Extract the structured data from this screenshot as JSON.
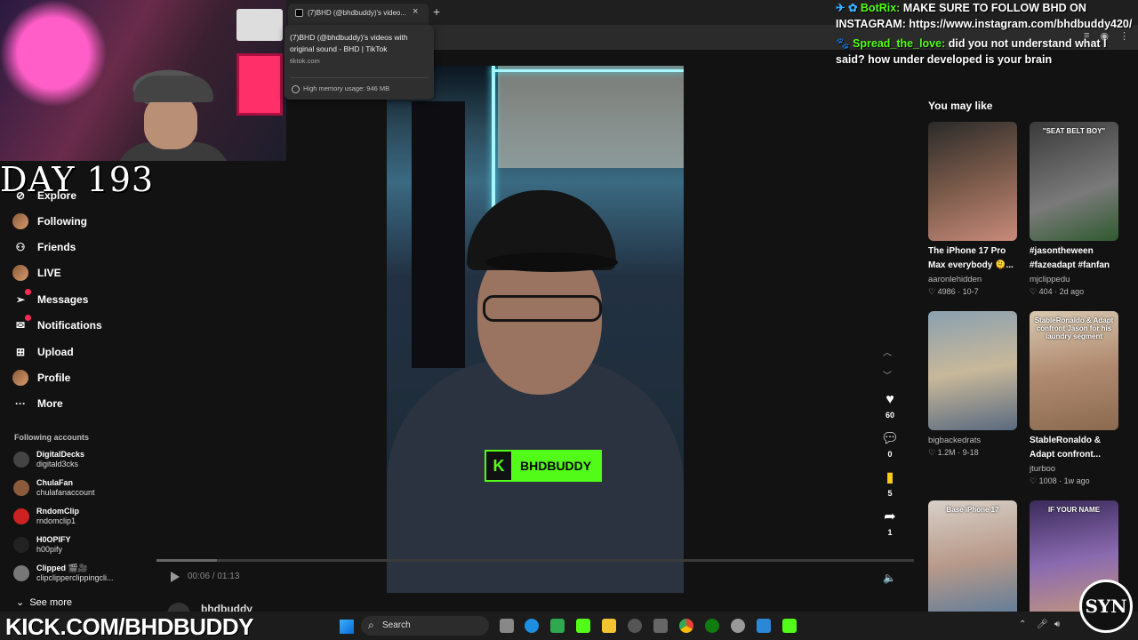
{
  "browser": {
    "tab_title": "(7)BHD (@bhdbuddy)'s video...",
    "tab_close": "×",
    "new_tab": "+",
    "tooltip": {
      "title": "(7)BHD (@bhdbuddy)'s videos with original sound - BHD | TikTok",
      "url": "tiktok.com",
      "memory": "High memory usage: 946 MB"
    }
  },
  "stream": {
    "day_label": "DAY 193",
    "kick_url": "KICK.COM/BHDBUDDY",
    "kick_tag": "BHDBUDDY",
    "kick_k": "K"
  },
  "sidebar": {
    "items": [
      {
        "label": "Explore",
        "icon": "compass-icon"
      },
      {
        "label": "Following",
        "icon": "avatar"
      },
      {
        "label": "Friends",
        "icon": "friends-icon"
      },
      {
        "label": "LIVE",
        "icon": "avatar"
      },
      {
        "label": "Messages",
        "icon": "send-icon",
        "badge": "3"
      },
      {
        "label": "Notifications",
        "icon": "inbox-icon",
        "badge": "4"
      },
      {
        "label": "Upload",
        "icon": "plus-square-icon"
      },
      {
        "label": "Profile",
        "icon": "avatar"
      },
      {
        "label": "More",
        "icon": "more-icon"
      }
    ],
    "following_header": "Following accounts",
    "following": [
      {
        "name": "DigitalDecks",
        "handle": "digitald3cks",
        "color": "#444"
      },
      {
        "name": "ChulaFan",
        "handle": "chulafanaccount",
        "color": "#8a5a3c"
      },
      {
        "name": "RndomClip",
        "handle": "rndomclip1",
        "color": "#c22"
      },
      {
        "name": "H0OPIFY",
        "handle": "h00pify",
        "color": "#222"
      },
      {
        "name": "Clipped 🎬🎥",
        "handle": "clipclipperclippingcli...",
        "color": "#777"
      }
    ],
    "see_more": "See more"
  },
  "player": {
    "time": "00:06 / 01:13",
    "progress": 0.08,
    "author": "bhdbuddy"
  },
  "actions": {
    "likes": "60",
    "comments": "0",
    "saves": "5",
    "shares": "1"
  },
  "recommendations": {
    "header": "You may like",
    "cards": [
      {
        "title": "The iPhone 17 Pro Max everybody 🫠...",
        "author": "aaronlehidden",
        "likes": "4986",
        "date": "10-7",
        "overlay": "",
        "bg": "linear-gradient(160deg,#2a2a2a,#7a5a4a 50%,#c88a7a)"
      },
      {
        "title": "#jasontheween #fazeadapt #fanfan",
        "author": "mjclippedu",
        "likes": "404",
        "date": "2d ago",
        "overlay": "\"SEAT BELT BOY\"",
        "bg": "linear-gradient(160deg,#3a3a3a,#7a7a7a 60%,#2f5a2f)"
      },
      {
        "title": "",
        "author": "bigbackedrats",
        "likes": "1.2M",
        "date": "9-18",
        "overlay": "",
        "bg": "linear-gradient(170deg,#8aa0b0,#c8b89a 50%,#5a6a80)"
      },
      {
        "title": "StableRonaldo & Adapt confront...",
        "author": "jturboo",
        "likes": "1008",
        "date": "1w ago",
        "overlay": "StableRonaldo & Adapt confront Jason for his laundry segment",
        "bg": "linear-gradient(170deg,#d8c8b0,#b08a70 50%,#8a6a50)"
      },
      {
        "title": "",
        "author": "",
        "likes": "",
        "date": "",
        "overlay": "Base iPhone 17",
        "bg": "linear-gradient(170deg,#d8d0c8,#b89a8a 50%,#5a7a9a)"
      },
      {
        "title": "",
        "author": "",
        "likes": "",
        "date": "",
        "overlay": "IF YOUR NAME",
        "bg": "linear-gradient(170deg,#3a2a5a,#8a6ab0 50%,#c89a7a)"
      }
    ]
  },
  "chat": [
    {
      "user": "BotRix:",
      "text": "MAKE SURE TO FOLLOW BHD ON INSTAGRAM: https://www.instagram.com/bhdbuddy420/",
      "icon": "✈ ✿"
    },
    {
      "user": "Spread_the_love:",
      "text": "did you not understand what I said? how under developed is your brain",
      "icon": "🐾"
    }
  ],
  "taskbar": {
    "search": "Search"
  },
  "logo_text": "SYN"
}
